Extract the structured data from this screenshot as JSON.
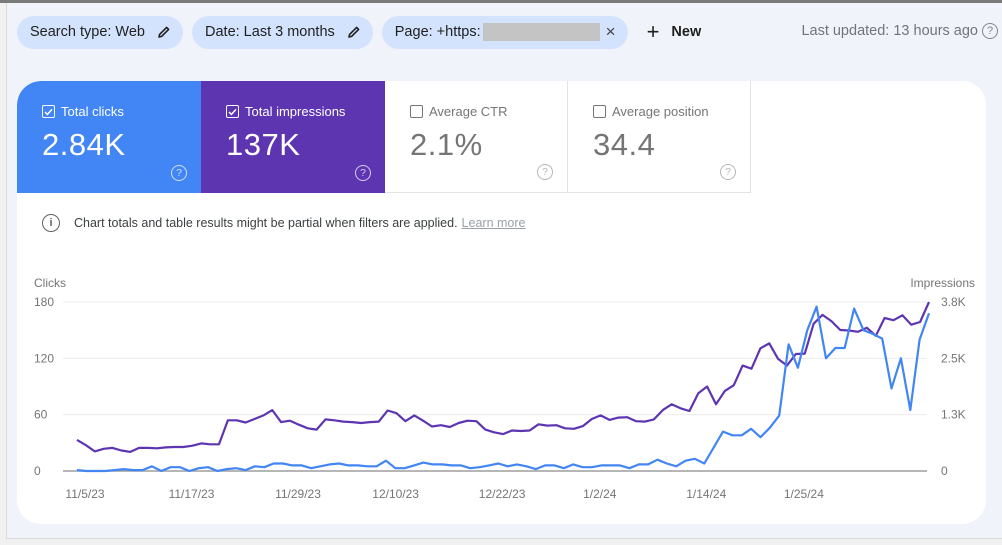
{
  "filters": {
    "chips": [
      {
        "label": "Search type: Web",
        "icon": "pencil-icon"
      },
      {
        "label": "Date: Last 3 months",
        "icon": "pencil-icon"
      },
      {
        "label": "Page: +https:",
        "icon": "close-icon",
        "redacted": true
      }
    ],
    "new_label": "New",
    "last_updated": "Last updated: 13 hours ago"
  },
  "metrics": [
    {
      "label": "Total clicks",
      "value": "2.84K",
      "checked": true,
      "color": "#4285f4"
    },
    {
      "label": "Total impressions",
      "value": "137K",
      "checked": true,
      "color": "#5e35b1"
    },
    {
      "label": "Average CTR",
      "value": "2.1%",
      "checked": false
    },
    {
      "label": "Average position",
      "value": "34.4",
      "checked": false
    }
  ],
  "notice": {
    "text": "Chart totals and table results might be partial when filters are applied.",
    "link": "Learn more"
  },
  "chart_data": {
    "type": "line",
    "title": "",
    "left_axis": {
      "label": "Clicks",
      "ticks": [
        "180",
        "120",
        "60",
        "0"
      ],
      "tick_values": [
        180,
        120,
        60,
        0
      ],
      "range": [
        0,
        180
      ]
    },
    "right_axis": {
      "label": "Impressions",
      "ticks": [
        "3.8K",
        "2.5K",
        "1.3K",
        "0"
      ],
      "tick_values": [
        3800,
        2533,
        1267,
        0
      ],
      "range": [
        0,
        3800
      ]
    },
    "x_tick_labels": [
      "11/5/23",
      "11/17/23",
      "11/29/23",
      "12/10/23",
      "12/22/23",
      "1/2/24",
      "1/14/24",
      "1/25/24"
    ],
    "x_tick_indices": [
      0,
      12,
      24,
      35,
      47,
      58,
      70,
      81
    ],
    "grid": true,
    "legend": "none",
    "series": [
      {
        "name": "Clicks",
        "axis": "left",
        "color": "#4285f4",
        "values": [
          1,
          0,
          0,
          0,
          1,
          2,
          1,
          1,
          5,
          0,
          4,
          4,
          0,
          3,
          4,
          0,
          2,
          3,
          1,
          5,
          4,
          8,
          8,
          6,
          6,
          3,
          5,
          7,
          8,
          6,
          6,
          5,
          5,
          11,
          3,
          3,
          6,
          9,
          7,
          7,
          6,
          6,
          3,
          4,
          6,
          8,
          5,
          7,
          5,
          2,
          6,
          6,
          3,
          7,
          4,
          4,
          6,
          6,
          6,
          3,
          7,
          7,
          12,
          8,
          5,
          11,
          13,
          8,
          25,
          42,
          38,
          38,
          45,
          36,
          46,
          59,
          135,
          110,
          150,
          175,
          120,
          131,
          131,
          173,
          150,
          146,
          141,
          88,
          120,
          65,
          140,
          168
        ]
      },
      {
        "name": "Impressions",
        "axis": "right",
        "color": "#5e35b1",
        "values": [
          700,
          580,
          440,
          500,
          520,
          460,
          430,
          520,
          520,
          510,
          530,
          540,
          540,
          570,
          620,
          600,
          600,
          1140,
          1140,
          1090,
          1170,
          1250,
          1370,
          1100,
          1130,
          1040,
          960,
          930,
          1160,
          1140,
          1110,
          1100,
          1080,
          1100,
          1110,
          1360,
          1300,
          1120,
          1250,
          1130,
          1000,
          1030,
          990,
          1080,
          1130,
          1120,
          930,
          870,
          830,
          910,
          900,
          910,
          1050,
          1020,
          1030,
          960,
          950,
          1010,
          1170,
          1250,
          1150,
          1200,
          1210,
          1120,
          1110,
          1160,
          1370,
          1500,
          1410,
          1350,
          1750,
          1900,
          1500,
          1800,
          1930,
          2370,
          2300,
          2760,
          2870,
          2520,
          2370,
          2630,
          2640,
          3310,
          3510,
          3370,
          3170,
          3160,
          3130,
          3220,
          3040,
          3440,
          3390,
          3500,
          3290,
          3350,
          3800
        ]
      }
    ]
  }
}
